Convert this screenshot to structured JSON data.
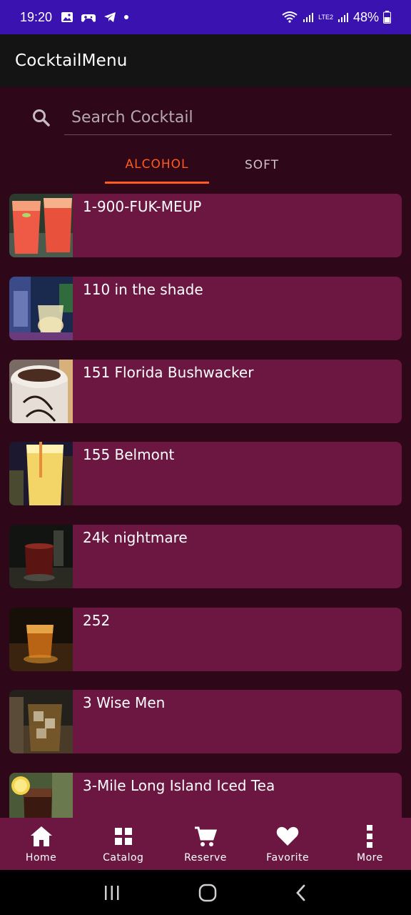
{
  "status_bar": {
    "time": "19:20",
    "battery": "48%",
    "network_label": "LTE2"
  },
  "app_bar": {
    "title": "CocktailMenu"
  },
  "search": {
    "placeholder": "Search Cocktail",
    "value": ""
  },
  "tabs": [
    {
      "label": "ALCOHOL",
      "active": true
    },
    {
      "label": "SOFT",
      "active": false
    }
  ],
  "cocktails": [
    {
      "name": "1-900-FUK-MEUP"
    },
    {
      "name": "110 in the shade"
    },
    {
      "name": "151 Florida Bushwacker"
    },
    {
      "name": "155 Belmont"
    },
    {
      "name": "24k nightmare"
    },
    {
      "name": "252"
    },
    {
      "name": "3 Wise Men"
    },
    {
      "name": "3-Mile Long Island Iced Tea"
    }
  ],
  "bottom_nav": [
    {
      "label": "Home",
      "icon": "home-icon"
    },
    {
      "label": "Catalog",
      "icon": "grid-icon"
    },
    {
      "label": "Reserve",
      "icon": "cart-icon"
    },
    {
      "label": "Favorite",
      "icon": "heart-icon"
    },
    {
      "label": "More",
      "icon": "more-vertical-icon"
    }
  ],
  "colors": {
    "background": "#2e0718",
    "card": "#6b1741",
    "accent": "#ff5a1f",
    "app_bar": "#141414",
    "status_bar": "#3a12b0"
  }
}
